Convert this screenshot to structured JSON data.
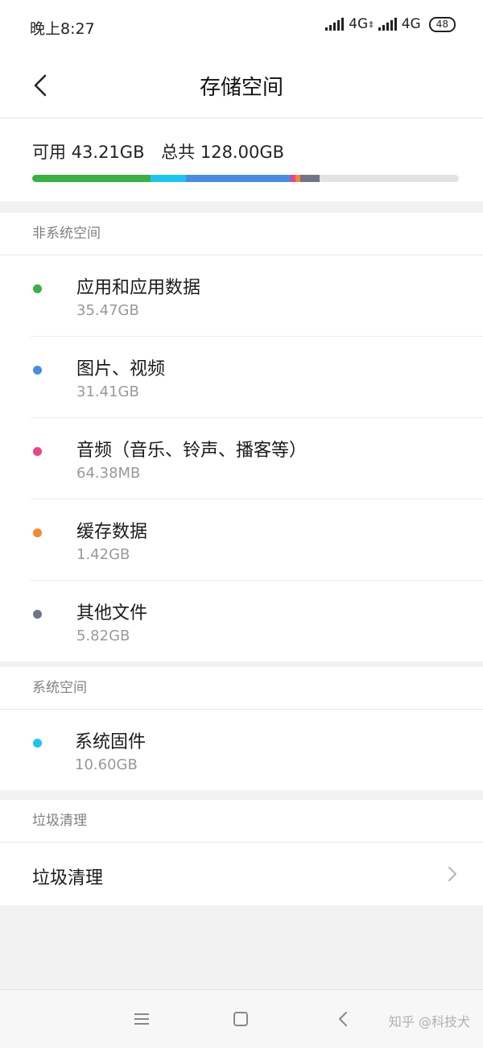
{
  "status_bar": {
    "time": "晚上8:27",
    "network_1": "4G",
    "network_1_suffix": "‡",
    "network_2": "4G",
    "battery": "48"
  },
  "header": {
    "title": "存储空间",
    "back_icon": "chevron-left-icon"
  },
  "summary": {
    "available": "可用 43.21GB",
    "total": "总共 128.00GB",
    "bar_segments": [
      {
        "name": "应用和应用数据",
        "fraction": 0.277,
        "color": "#3cb043"
      },
      {
        "name": "系统固件",
        "fraction": 0.083,
        "color": "#1fc4ee"
      },
      {
        "name": "图片、视频",
        "fraction": 0.245,
        "color": "#4a8be0"
      },
      {
        "name": "音频",
        "fraction": 0.012,
        "color": "#e7468b"
      },
      {
        "name": "缓存数据",
        "fraction": 0.011,
        "color": "#f08a30"
      },
      {
        "name": "其他文件",
        "fraction": 0.045,
        "color": "#6e7787"
      }
    ],
    "bar_background": "#e3e3e3"
  },
  "non_system": {
    "header": "非系统空间",
    "items": [
      {
        "title": "应用和应用数据",
        "size": "35.47GB",
        "color": "#3cb043"
      },
      {
        "title": "图片、视频",
        "size": "31.41GB",
        "color": "#4a8be0"
      },
      {
        "title": "音频（音乐、铃声、播客等）",
        "size": "64.38MB",
        "color": "#e7468b"
      },
      {
        "title": "缓存数据",
        "size": "1.42GB",
        "color": "#f08a30"
      },
      {
        "title": "其他文件",
        "size": "5.82GB",
        "color": "#6e7787"
      }
    ]
  },
  "system": {
    "header": "系统空间",
    "items": [
      {
        "title": "系统固件",
        "size": "10.60GB",
        "color": "#1fc4ee"
      }
    ]
  },
  "cleanup": {
    "header": "垃圾清理",
    "row_label": "垃圾清理",
    "chevron_icon": "chevron-right-icon"
  },
  "nav_bar": {
    "menu_icon": "menu-icon",
    "home_icon": "home-square-icon",
    "back_icon": "back-triangle-icon",
    "watermark": "知乎 @科技犬"
  }
}
